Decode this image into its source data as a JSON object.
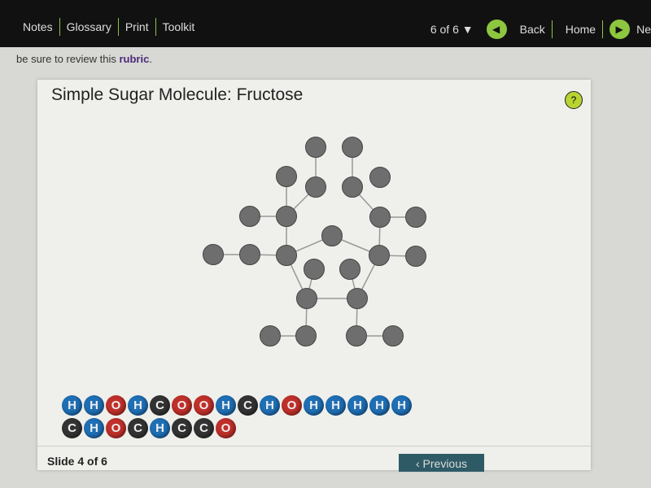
{
  "topbar": {
    "left": [
      "Notes",
      "Glossary",
      "Print",
      "Toolkit"
    ],
    "page": "6 of 6 ▼",
    "back": "Back",
    "home": "Home",
    "next": "Ne"
  },
  "intro": {
    "text": "be sure to review this ",
    "link": "rubric",
    "end": "."
  },
  "card": {
    "title": "Simple Sugar Molecule: Fructose",
    "help": "?"
  },
  "atom_colors": {
    "H": "#1f6fb5",
    "O": "#c0302a",
    "C": "#333333"
  },
  "atom_bank": [
    [
      "H",
      "H",
      "O",
      "H",
      "C",
      "O",
      "O",
      "H",
      "C",
      "H",
      "O",
      "H",
      "H",
      "H",
      "H",
      "H"
    ],
    [
      "C",
      "H",
      "O",
      "C",
      "H",
      "C",
      "C",
      "O"
    ]
  ],
  "footer": {
    "slide": "Slide 4 of 6",
    "previous": "‹ Previous"
  }
}
